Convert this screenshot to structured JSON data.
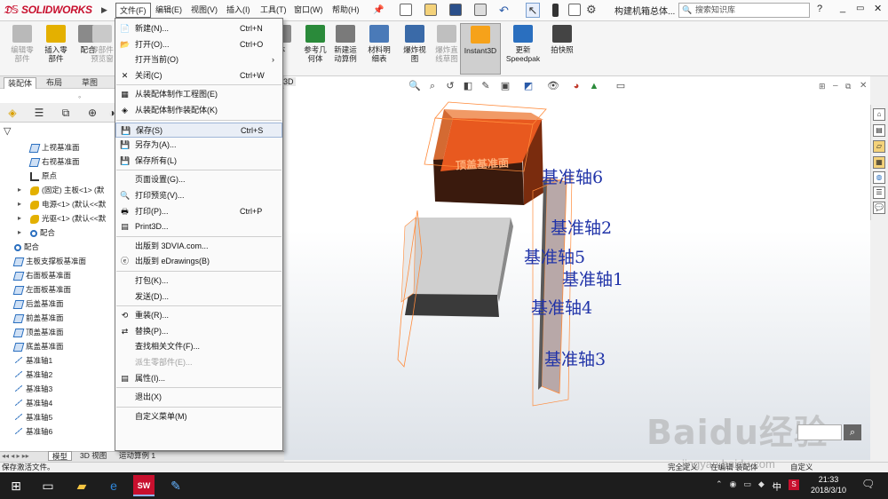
{
  "app": {
    "logo": "SOLIDWORKS",
    "doc_title": "构建机箱总体...",
    "search_placeholder": "搜索知识库"
  },
  "menubar": [
    "文件(F)",
    "编辑(E)",
    "视图(V)",
    "插入(I)",
    "工具(T)",
    "窗口(W)",
    "帮助(H)"
  ],
  "commands": [
    {
      "label": "编辑零\n部件",
      "dim": true
    },
    {
      "label": "插入零\n部件",
      "dim": false
    },
    {
      "label": "配合",
      "dim": false
    },
    {
      "label": "零部件\n预览窗",
      "dim": true
    },
    {
      "label": "体",
      "dim": false
    },
    {
      "label": "参考几\n何体",
      "dim": false
    },
    {
      "label": "新建运\n动算例",
      "dim": false
    },
    {
      "label": "材料明\n细表",
      "dim": false
    },
    {
      "label": "爆炸视\n图",
      "dim": false
    },
    {
      "label": "爆炸直\n线草图",
      "dim": true
    },
    {
      "label": "Instant3D",
      "dim": false,
      "active": true
    },
    {
      "label": "更新\nSpeedpak",
      "dim": false
    },
    {
      "label": "拍快照",
      "dim": false
    }
  ],
  "tabs": [
    "装配体",
    "布局",
    "草图",
    "3D"
  ],
  "tree": [
    {
      "label": "上视基准面",
      "type": "plane",
      "indent": 1
    },
    {
      "label": "右视基准面",
      "type": "plane",
      "indent": 1
    },
    {
      "label": "原点",
      "type": "orig",
      "indent": 1
    },
    {
      "label": "(固定) 主板<1> (默",
      "type": "part",
      "indent": 0,
      "expand": true
    },
    {
      "label": "电源<1> (默认<<默",
      "type": "part",
      "indent": 0,
      "expand": true
    },
    {
      "label": "光驱<1> (默认<<默",
      "type": "part",
      "indent": 0,
      "expand": true
    },
    {
      "label": "配合",
      "type": "mate",
      "indent": 0,
      "expand": true
    },
    {
      "label": "配合",
      "type": "mate",
      "indent": -1
    },
    {
      "label": "主板支撑板基准面",
      "type": "plane",
      "indent": -1
    },
    {
      "label": "右面板基准面",
      "type": "plane",
      "indent": -1
    },
    {
      "label": "左面板基准面",
      "type": "plane",
      "indent": -1
    },
    {
      "label": "后盖基准面",
      "type": "plane",
      "indent": -1
    },
    {
      "label": "前盖基准面",
      "type": "plane",
      "indent": -1
    },
    {
      "label": "顶盖基准面",
      "type": "plane",
      "indent": -1
    },
    {
      "label": "底盖基准面",
      "type": "plane",
      "indent": -1
    },
    {
      "label": "基准轴1",
      "type": "axis",
      "indent": -1
    },
    {
      "label": "基准轴2",
      "type": "axis",
      "indent": -1
    },
    {
      "label": "基准轴3",
      "type": "axis",
      "indent": -1
    },
    {
      "label": "基准轴4",
      "type": "axis",
      "indent": -1
    },
    {
      "label": "基准轴5",
      "type": "axis",
      "indent": -1
    },
    {
      "label": "基准轴6",
      "type": "axis",
      "indent": -1
    }
  ],
  "file_menu": [
    {
      "label": "新建(N)...",
      "shortcut": "Ctrl+N"
    },
    {
      "label": "打开(O)...",
      "shortcut": "Ctrl+O"
    },
    {
      "label": "打开当前(O)",
      "submenu": true
    },
    {
      "label": "关闭(C)",
      "shortcut": "Ctrl+W"
    },
    {
      "sep": true
    },
    {
      "label": "从装配体制作工程图(E)"
    },
    {
      "label": "从装配体制作装配体(K)"
    },
    {
      "sep": true
    },
    {
      "label": "保存(S)",
      "shortcut": "Ctrl+S",
      "highlight": true
    },
    {
      "label": "另存为(A)..."
    },
    {
      "label": "保存所有(L)"
    },
    {
      "sep": true
    },
    {
      "label": "页面设置(G)..."
    },
    {
      "label": "打印预览(V)..."
    },
    {
      "label": "打印(P)...",
      "shortcut": "Ctrl+P"
    },
    {
      "label": "Print3D..."
    },
    {
      "sep": true
    },
    {
      "label": "出版到 3DVIA.com..."
    },
    {
      "label": "出版到 eDrawings(B)"
    },
    {
      "sep": true
    },
    {
      "label": "打包(K)..."
    },
    {
      "label": "发送(D)..."
    },
    {
      "sep": true
    },
    {
      "label": "重装(R)..."
    },
    {
      "label": "替换(P)..."
    },
    {
      "label": "查找相关文件(F)..."
    },
    {
      "label": "派生零部件(E)...",
      "disabled": true
    },
    {
      "label": "属性(I)..."
    },
    {
      "sep": true
    },
    {
      "label": "退出(X)"
    },
    {
      "sep": true
    },
    {
      "label": "自定义菜单(M)"
    }
  ],
  "viewport": {
    "top_plane_label": "顶盖基准面",
    "axis_labels": [
      "基准轴6",
      "基准轴2",
      "基准轴5",
      "基准轴1",
      "基准轴4",
      "基准轴3"
    ]
  },
  "bottom_tabs": [
    "模型",
    "3D 视图",
    "运动算例 1"
  ],
  "status": {
    "left": "保存激活文件。",
    "right1": "完全定义",
    "right2": "在编辑 装配体",
    "right3": "自定义"
  },
  "clock": {
    "time": "21:33",
    "date": "2018/3/10"
  },
  "ime": "中",
  "watermark": {
    "brand": "Baidu经验",
    "url": "jingyan.baidu.com"
  }
}
